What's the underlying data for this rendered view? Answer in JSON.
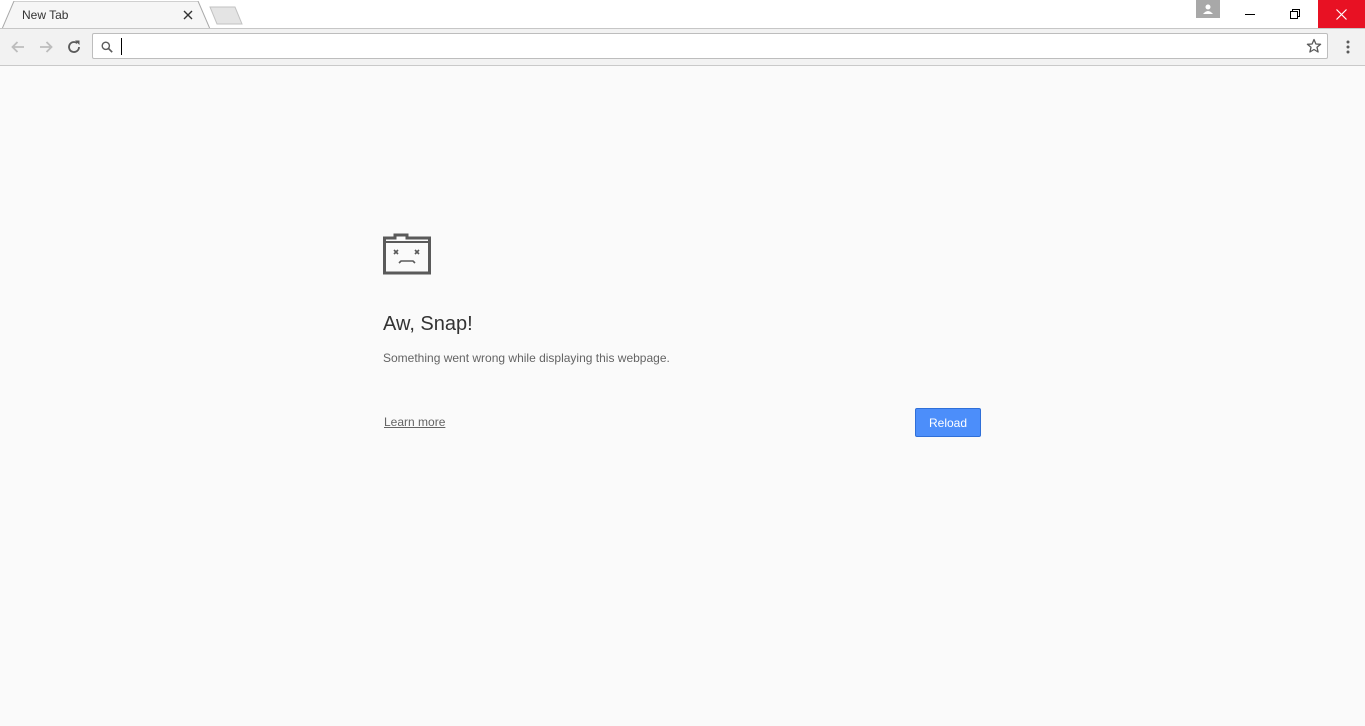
{
  "browser": {
    "tab": {
      "title": "New Tab"
    },
    "omnibox": {
      "value": "",
      "placeholder": ""
    }
  },
  "icons": {
    "tab_close": "close-icon",
    "new_tab": "new-tab-icon",
    "profile": "avatar-icon",
    "minimize": "minimize-icon",
    "restore": "restore-icon",
    "close_window": "close-icon",
    "back": "arrow-left-icon",
    "forward": "arrow-right-icon",
    "reload": "reload-icon",
    "search": "search-icon",
    "bookmark": "star-icon",
    "menu": "more-vertical-icon",
    "sad_tab": "sad-tab-icon"
  },
  "error_page": {
    "heading": "Aw, Snap!",
    "message": "Something went wrong while displaying this webpage.",
    "learn_more": "Learn more",
    "reload_button": "Reload"
  },
  "colors": {
    "page_background": "#fafafa",
    "reload_button": "#4c8efa",
    "close_button_hover": "#e81123",
    "heading_text": "#333333",
    "body_text": "#646464"
  }
}
